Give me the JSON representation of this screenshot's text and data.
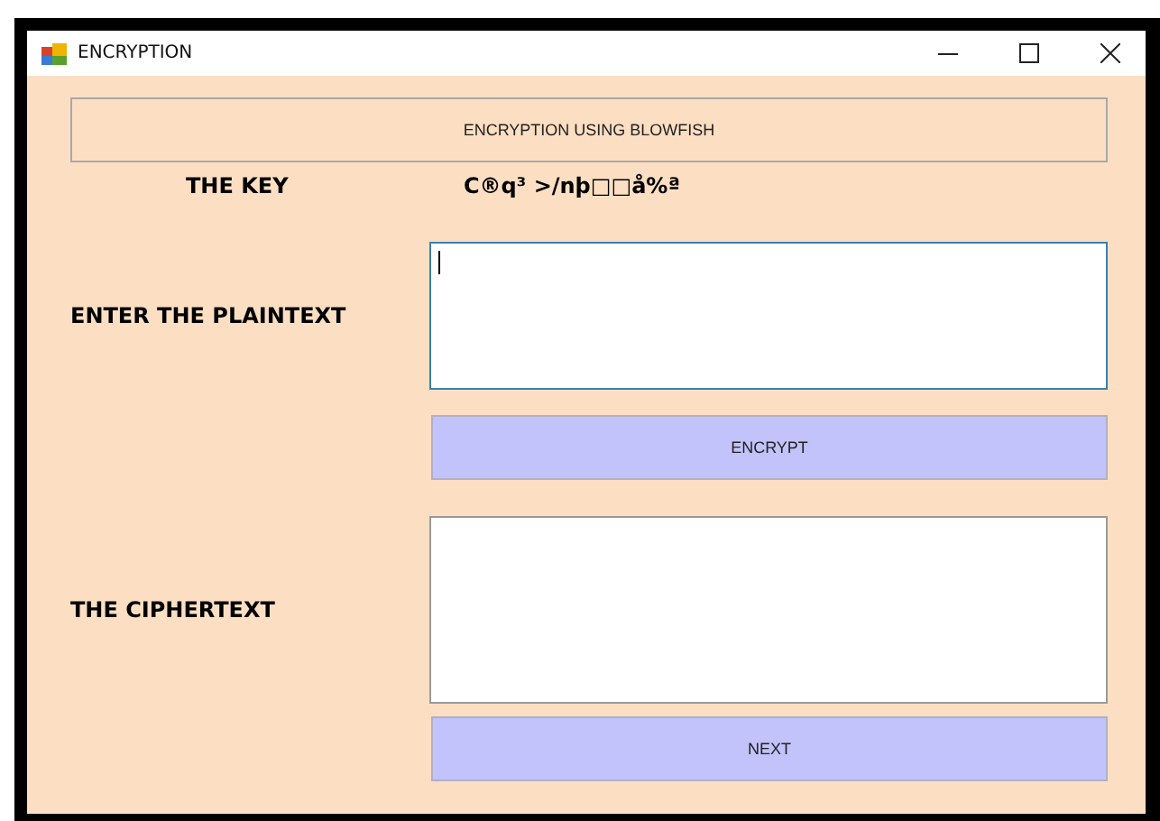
{
  "window": {
    "title": "ENCRYPTION"
  },
  "header": "ENCRYPTION USING BLOWFISH",
  "key": {
    "label": "THE KEY",
    "value": "C®q³  >/nþ□□å%ª"
  },
  "plaintext": {
    "label": "ENTER THE PLAINTEXT",
    "focused": true
  },
  "encrypt_button": "ENCRYPT",
  "ciphertext": {
    "label": "THE CIPHERTEXT",
    "focused": false
  },
  "next_button": "NEXT"
}
